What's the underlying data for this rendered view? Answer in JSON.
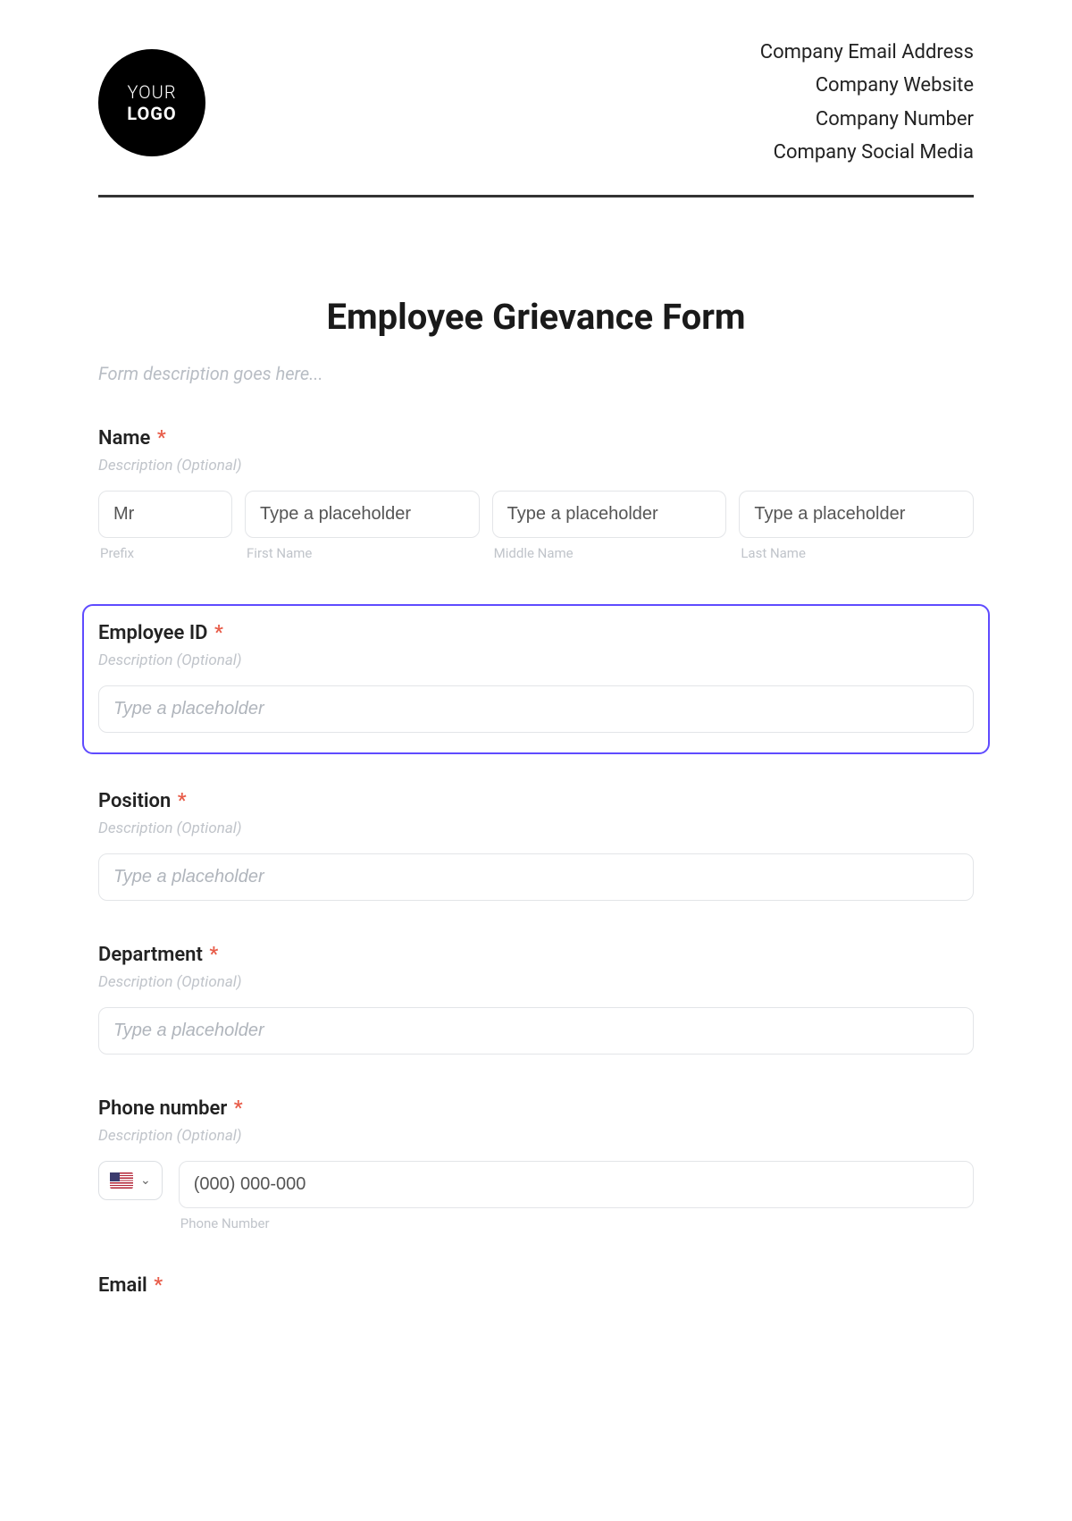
{
  "header": {
    "logo_line1": "YOUR",
    "logo_line2": "LOGO",
    "company_lines": [
      "Company Email Address",
      "Company Website",
      "Company Number",
      "Company Social Media"
    ]
  },
  "form": {
    "title": "Employee Grievance Form",
    "description": "Form description goes here..."
  },
  "fields": {
    "name": {
      "label": "Name",
      "required_mark": "*",
      "sub": "Description (Optional)",
      "prefix": {
        "value": "Mr",
        "sublabel": "Prefix"
      },
      "first": {
        "placeholder": "Type a placeholder",
        "sublabel": "First Name"
      },
      "middle": {
        "placeholder": "Type a placeholder",
        "sublabel": "Middle Name"
      },
      "last": {
        "placeholder": "Type a placeholder",
        "sublabel": "Last Name"
      }
    },
    "employee_id": {
      "label": "Employee ID",
      "required_mark": "*",
      "sub": "Description (Optional)",
      "placeholder": "Type a placeholder"
    },
    "position": {
      "label": "Position",
      "required_mark": "*",
      "sub": "Description (Optional)",
      "placeholder": "Type a placeholder"
    },
    "department": {
      "label": "Department",
      "required_mark": "*",
      "sub": "Description (Optional)",
      "placeholder": "Type a placeholder"
    },
    "phone": {
      "label": "Phone number",
      "required_mark": "*",
      "sub": "Description (Optional)",
      "placeholder": "(000) 000-000",
      "sublabel": "Phone Number"
    },
    "email": {
      "label": "Email",
      "required_mark": "*"
    }
  }
}
